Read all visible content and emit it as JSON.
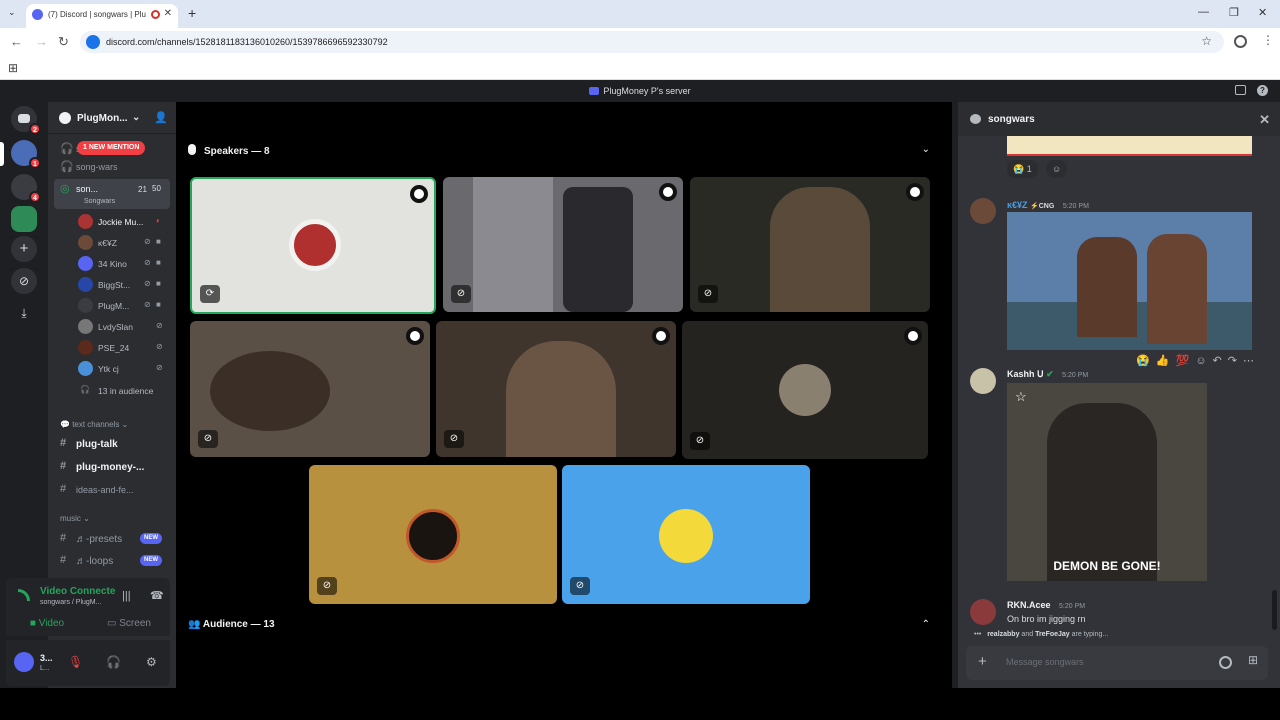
{
  "browser": {
    "tab_title": "(7) Discord | songwars | Plu",
    "url": "discord.com/channels/1528181183136010260/1539786696592330792"
  },
  "discord": {
    "window_title": "PlugMoney P's server"
  },
  "guilds": {
    "home_badge": "2",
    "badge2": "1",
    "badge3": "4"
  },
  "sidebar": {
    "server_name": "PlugMon...",
    "mention_badge": "1 NEW MENTION",
    "channel_song_wars": "song-wars",
    "voice_channel": "son...",
    "voice_channel_sub": "Songwars",
    "voice_count": "21",
    "voice_limit": "50",
    "members": [
      "Jockie Mu...",
      "ĸ€¥Z",
      "34 Kino",
      "BiggSt...",
      "PlugM...",
      "LvdySlan",
      "PSE_24",
      "Ytk cj"
    ],
    "audience_count": "13 in audience",
    "cat_text": "text channels",
    "text_channels": [
      "plug-talk",
      "plug-money-...",
      "ideas-and-fe..."
    ],
    "cat_music": "music",
    "music_channels": [
      "♬-presets",
      "♬-loops"
    ],
    "new_label": "NEW"
  },
  "voice_panel": {
    "status": "Video Connecte",
    "sub": "songwars / PlugM...",
    "video_btn": "Video",
    "screen_btn": "Screen"
  },
  "user_panel": {
    "name": "3...",
    "status": "L..."
  },
  "stage": {
    "speakers_header": "Speakers — 8",
    "audience_header": "Audience — 13"
  },
  "chat": {
    "title": "songwars",
    "reaction_count": "1",
    "msg1_author": "ĸ€¥Z",
    "msg1_tag": "CNG",
    "msg1_time": "5:20 PM",
    "msg2_author": "Kashh ᑌ",
    "msg2_time": "5:20 PM",
    "gif_caption": "DEMON BE GONE!",
    "msg3_author": "RKN.Acee",
    "msg3_time": "5:20 PM",
    "msg3_text": "On bro im jigging rn",
    "typing_user1": "realzabby",
    "typing_and": " and ",
    "typing_user2": "TreFoeJay",
    "typing_suffix": " are typing...",
    "placeholder": "Message songwars"
  },
  "colors": {
    "discord_blurple": "#5865f2",
    "connected_green": "#23a55a",
    "mention_red": "#f23f43",
    "stage_tile_gold": "#b8913f",
    "stage_tile_blue": "#4aa3ea",
    "msg1_author": "#4a9fe0"
  }
}
